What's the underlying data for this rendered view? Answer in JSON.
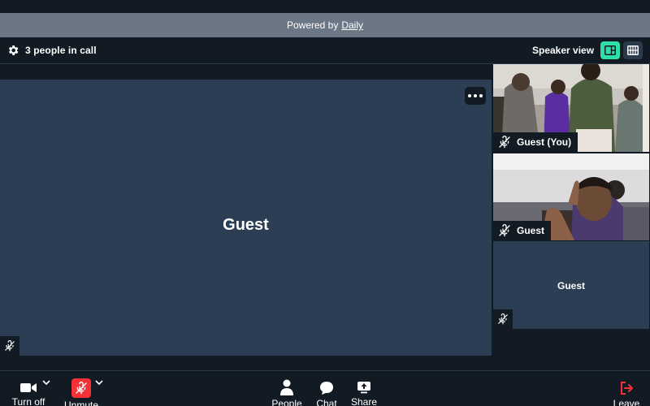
{
  "banner": {
    "prefix": "Powered by",
    "brand": "Daily"
  },
  "header": {
    "participant_count": "3 people in call",
    "view_label": "Speaker view",
    "colors": {
      "active_view": "#2fdfa8",
      "inactive_view": "#2b3a4b"
    }
  },
  "main_tile": {
    "name": "Guest"
  },
  "side_tiles": [
    {
      "name": "Guest (You)",
      "muted": true
    },
    {
      "name": "Guest",
      "muted": true
    },
    {
      "name": "Guest",
      "muted": true
    }
  ],
  "tray": {
    "camera_label": "Turn off",
    "mic_label": "Unmute",
    "people_label": "People",
    "chat_label": "Chat",
    "share_label": "Share",
    "leave_label": "Leave",
    "colors": {
      "mic_muted": "#f63135",
      "leave": "#f63135"
    }
  },
  "icons": [
    "gear-icon",
    "speaker-view-icon",
    "grid-view-icon",
    "more-icon",
    "mic-muted-icon",
    "camera-icon",
    "chevron-down-icon",
    "person-icon",
    "chat-icon",
    "share-icon",
    "leave-icon"
  ]
}
